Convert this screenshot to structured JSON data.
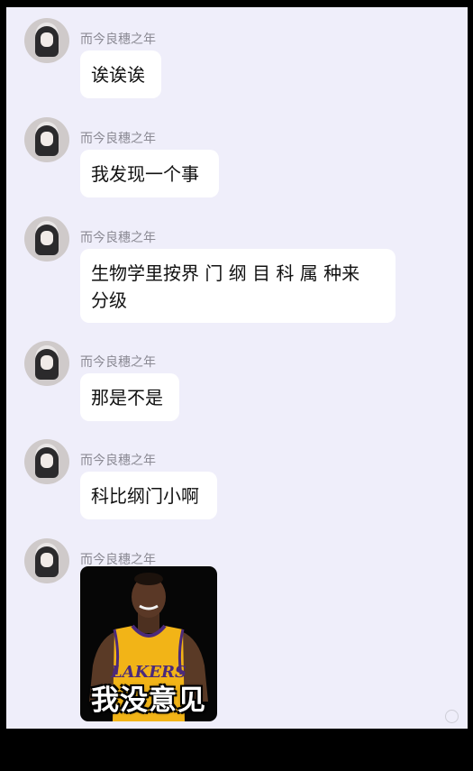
{
  "sender_name": "而今良穗之年",
  "messages": [
    {
      "type": "text",
      "text": "诶诶诶"
    },
    {
      "type": "text",
      "text": "我发现一个事"
    },
    {
      "type": "text",
      "line1": "生物学里按界 门 纲 目 科 属 种来",
      "line2": "分级"
    },
    {
      "type": "text",
      "text": "那是不是"
    },
    {
      "type": "text",
      "text": "科比纲门小啊"
    },
    {
      "type": "image",
      "jersey_text": "LAKERS",
      "caption": "我没意见"
    }
  ],
  "icons": [
    "avatar",
    "meme-image",
    "watermark-icon"
  ],
  "colors": {
    "background": "#efeefa",
    "bubble": "#ffffff",
    "jersey": "#f2b417",
    "frame": "#000000"
  }
}
